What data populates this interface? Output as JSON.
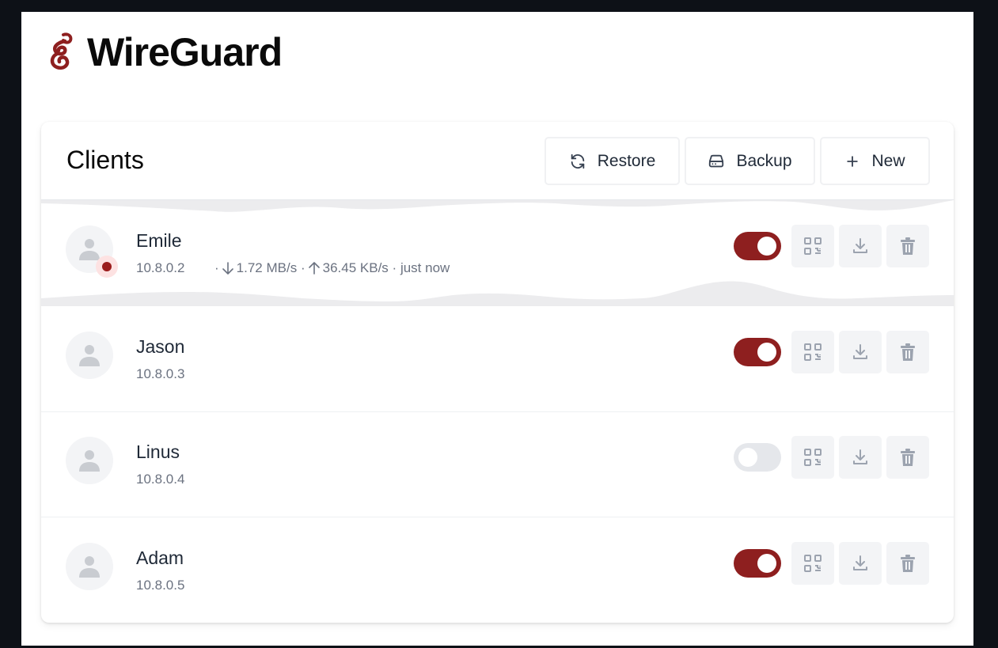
{
  "app": {
    "title": "WireGuard"
  },
  "card": {
    "title": "Clients",
    "buttons": {
      "restore": "Restore",
      "backup": "Backup",
      "new": "New"
    }
  },
  "clients": [
    {
      "name": "Emile",
      "ip": "10.8.0.2",
      "enabled": true,
      "connected": true,
      "stats": {
        "sep1": "·",
        "download": "1.72 MB/s",
        "sep2": "·",
        "upload": "36.45 KB/s",
        "sep3": "·",
        "last_seen": "just now"
      }
    },
    {
      "name": "Jason",
      "ip": "10.8.0.3",
      "enabled": true,
      "connected": false
    },
    {
      "name": "Linus",
      "ip": "10.8.0.4",
      "enabled": false,
      "connected": false
    },
    {
      "name": "Adam",
      "ip": "10.8.0.5",
      "enabled": true,
      "connected": false
    }
  ],
  "colors": {
    "accent": "#8e1f1f",
    "toggle_off": "#e5e7eb",
    "action_bg": "#f3f4f6",
    "icon": "#9ca3af"
  }
}
